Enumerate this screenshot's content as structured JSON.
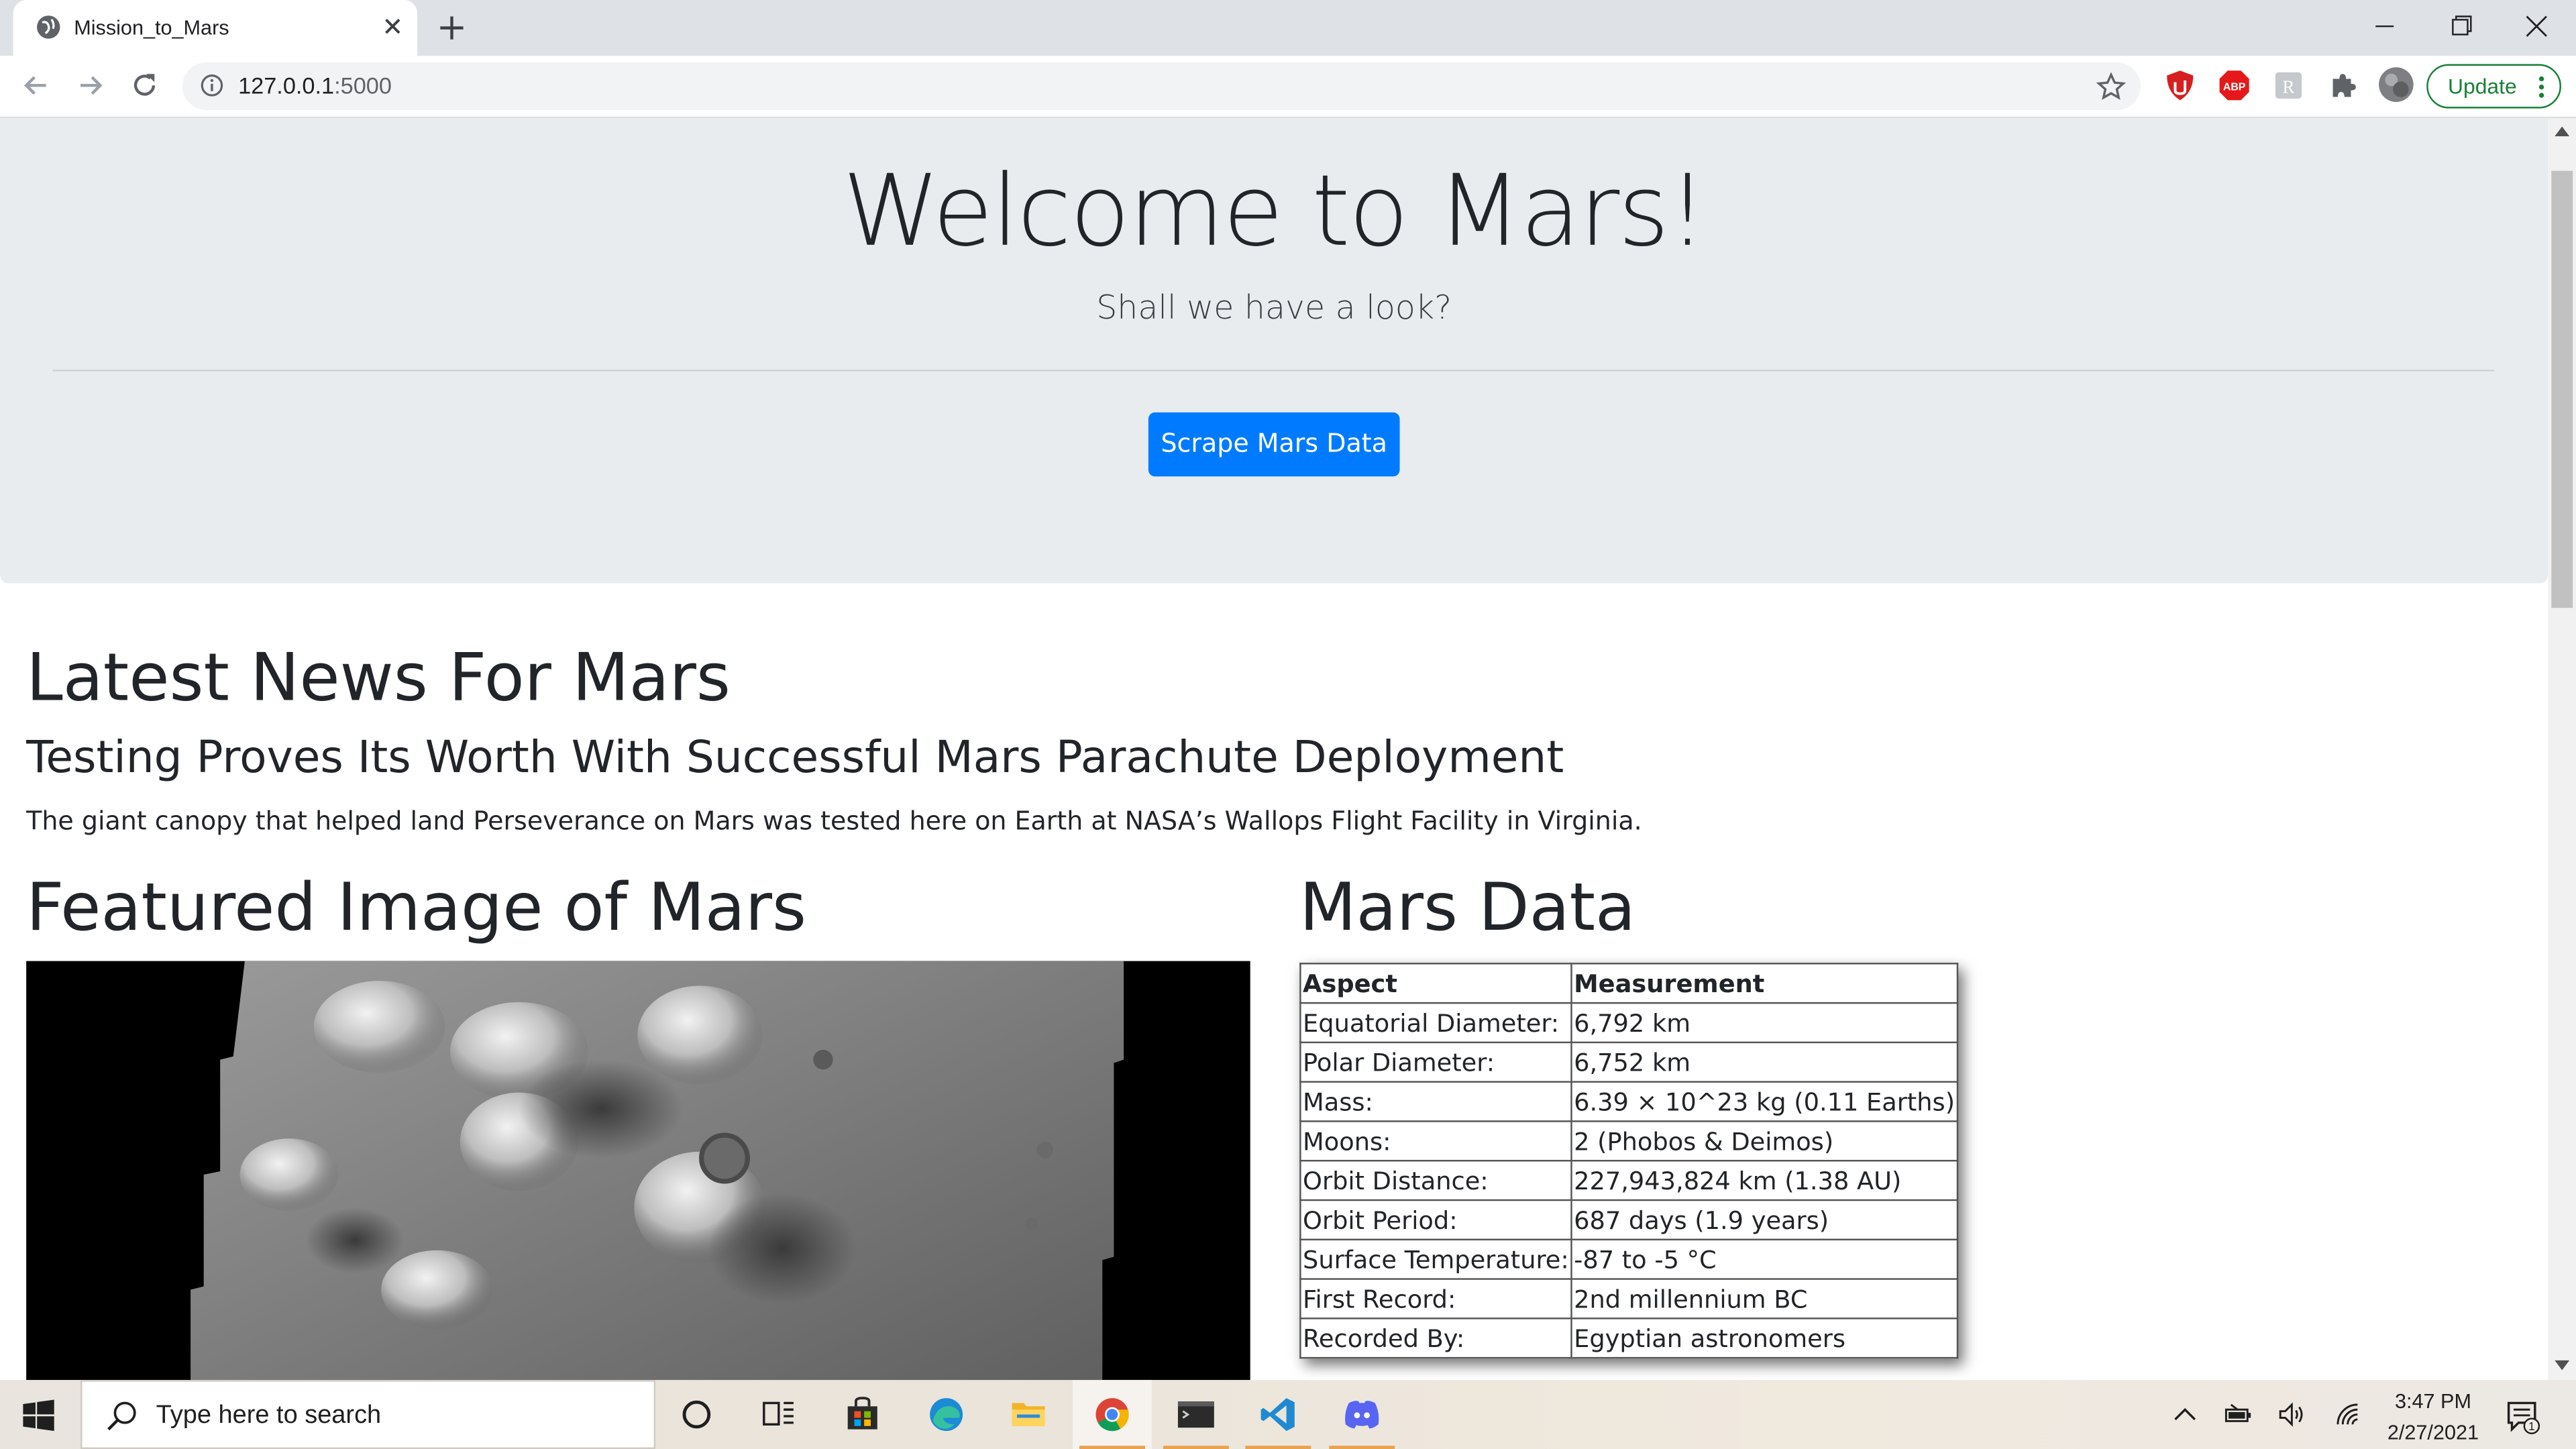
{
  "browser": {
    "tab_title": "Mission_to_Mars",
    "url_host": "127.0.0.1",
    "url_port": ":5000",
    "update_label": "Update"
  },
  "page": {
    "jumbotron": {
      "title": "Welcome to Mars!",
      "lead": "Shall we have a look?",
      "button_label": "Scrape Mars Data"
    },
    "news": {
      "heading": "Latest News For Mars",
      "title": "Testing Proves Its Worth With Successful Mars Parachute Deployment",
      "paragraph": "The giant canopy that helped land Perseverance on Mars was tested here on Earth at NASA’s Wallops Flight Facility in Virginia."
    },
    "featured": {
      "heading": "Featured Image of Mars"
    },
    "facts": {
      "heading": "Mars Data",
      "columns": [
        "Aspect",
        "Measurement"
      ],
      "rows": [
        [
          "Equatorial Diameter:",
          "6,792 km"
        ],
        [
          "Polar Diameter:",
          "6,752 km"
        ],
        [
          "Mass:",
          "6.39 × 10^23 kg (0.11 Earths)"
        ],
        [
          "Moons:",
          "2 (Phobos & Deimos)"
        ],
        [
          "Orbit Distance:",
          "227,943,824 km (1.38 AU)"
        ],
        [
          "Orbit Period:",
          "687 days (1.9 years)"
        ],
        [
          "Surface Temperature:",
          "-87 to -5 °C"
        ],
        [
          "First Record:",
          "2nd millennium BC"
        ],
        [
          "Recorded By:",
          "Egyptian astronomers"
        ]
      ]
    }
  },
  "taskbar": {
    "search_placeholder": "Type here to search",
    "time": "3:47 PM",
    "date": "2/27/2021",
    "apps": [
      "cortana",
      "task-view",
      "store",
      "edge",
      "file-explorer",
      "chrome",
      "terminal",
      "vscode",
      "discord"
    ]
  },
  "colors": {
    "primary_button": "#007bff",
    "jumbotron_bg": "#e9ecef",
    "update_green": "#188038"
  }
}
